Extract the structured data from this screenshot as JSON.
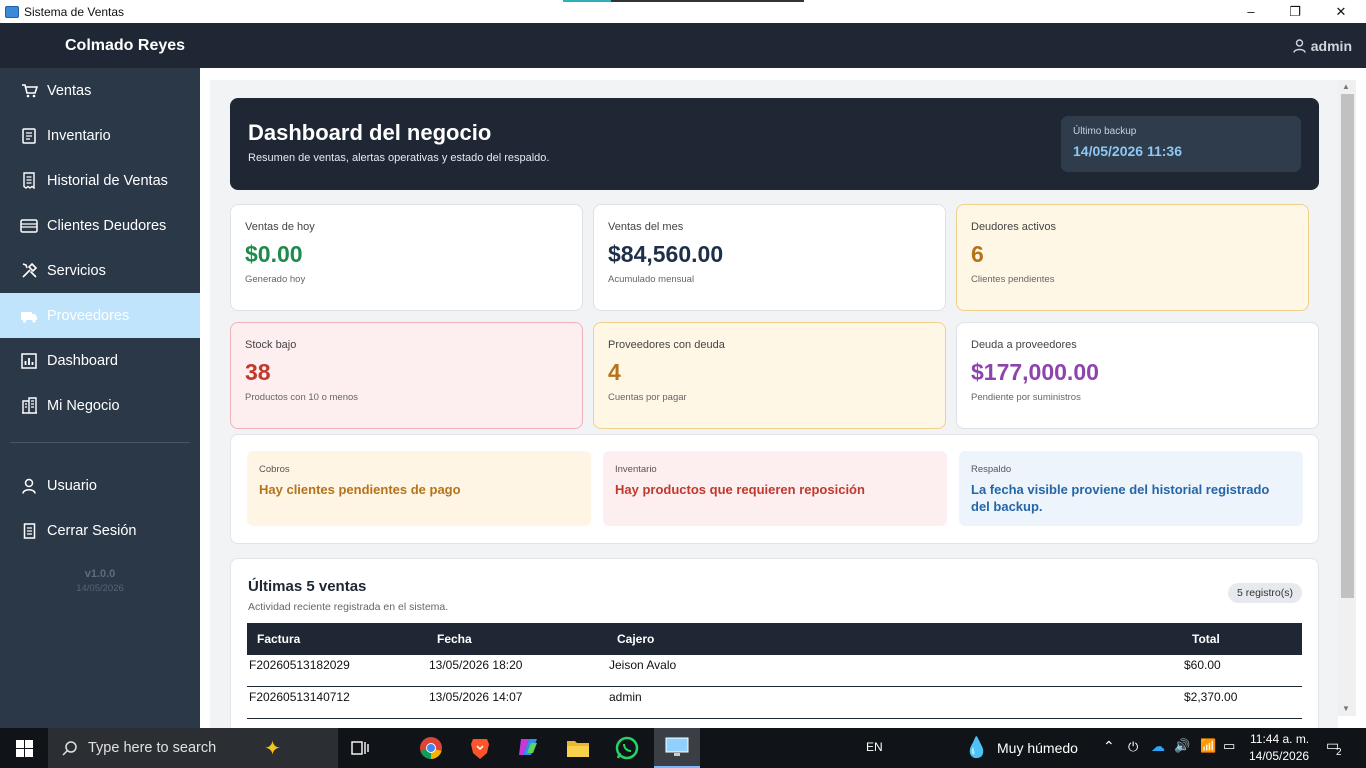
{
  "window": {
    "title": "Sistema de Ventas",
    "controls": [
      "–",
      "❐",
      "✕"
    ]
  },
  "header": {
    "brand": "Colmado Reyes",
    "user": "admin"
  },
  "sidebar": {
    "items": [
      {
        "label": "Ventas",
        "icon": "cart-icon"
      },
      {
        "label": "Inventario",
        "icon": "clipboard-icon"
      },
      {
        "label": "Historial de Ventas",
        "icon": "receipt-icon"
      },
      {
        "label": "Clientes Deudores",
        "icon": "card-icon"
      },
      {
        "label": "Servicios",
        "icon": "tools-icon"
      },
      {
        "label": "Proveedores",
        "icon": "truck-icon",
        "active": true
      },
      {
        "label": "Dashboard",
        "icon": "chart-icon"
      },
      {
        "label": "Mi Negocio",
        "icon": "building-icon"
      }
    ],
    "bottom": [
      {
        "label": "Usuario",
        "icon": "user-icon"
      },
      {
        "label": "Cerrar Sesión",
        "icon": "logout-icon"
      }
    ],
    "version": "v1.0.0",
    "date": "14/05/2026"
  },
  "hero": {
    "title": "Dashboard del negocio",
    "subtitle": "Resumen de ventas, alertas operativas y estado del respaldo.",
    "backup_label": "Último backup",
    "backup_value": "14/05/2026 11:36"
  },
  "cards": [
    {
      "label": "Ventas de hoy",
      "value": "$0.00",
      "sub": "Generado hoy",
      "color": "#1f8a4c"
    },
    {
      "label": "Ventas del mes",
      "value": "$84,560.00",
      "sub": "Acumulado mensual",
      "color": "#1e2f4a"
    },
    {
      "label": "Deudores activos",
      "value": "6",
      "sub": "Clientes pendientes",
      "color": "#b5731a"
    },
    {
      "label": "Stock bajo",
      "value": "38",
      "sub": "Productos con 10 o menos",
      "color": "#c0392b"
    },
    {
      "label": "Proveedores con deuda",
      "value": "4",
      "sub": "Cuentas por pagar",
      "color": "#b5731a"
    },
    {
      "label": "Deuda a proveedores",
      "value": "$177,000.00",
      "sub": "Pendiente por suministros",
      "color": "#8e44ad"
    }
  ],
  "alerts": [
    {
      "label": "Cobros",
      "message": "Hay clientes pendientes de pago",
      "color": "#b5731a",
      "bg": "#fff5e4"
    },
    {
      "label": "Inventario",
      "message": "Hay productos que requieren reposición",
      "color": "#c0392b",
      "bg": "#fdeef0"
    },
    {
      "label": "Respaldo",
      "message": "La fecha visible proviene del historial registrado del backup.",
      "color": "#2466a8",
      "bg": "#eef4fb"
    }
  ],
  "sales": {
    "title": "Últimas 5 ventas",
    "description": "Actividad reciente registrada en el sistema.",
    "badge": "5 registro(s)",
    "columns": [
      "Factura",
      "Fecha",
      "Cajero",
      "Total"
    ],
    "rows": [
      [
        "F20260513182029",
        "13/05/2026 18:20",
        "Jeison Avalo",
        "$60.00"
      ],
      [
        "F20260513140712",
        "13/05/2026 14:07",
        "admin",
        "$2,370.00"
      ]
    ]
  },
  "taskbar": {
    "search_placeholder": "Type here to search",
    "language": "EN",
    "weather": "Muy húmedo",
    "time": "11:44 a. m.",
    "date": "14/05/2026",
    "notifications": "2"
  }
}
